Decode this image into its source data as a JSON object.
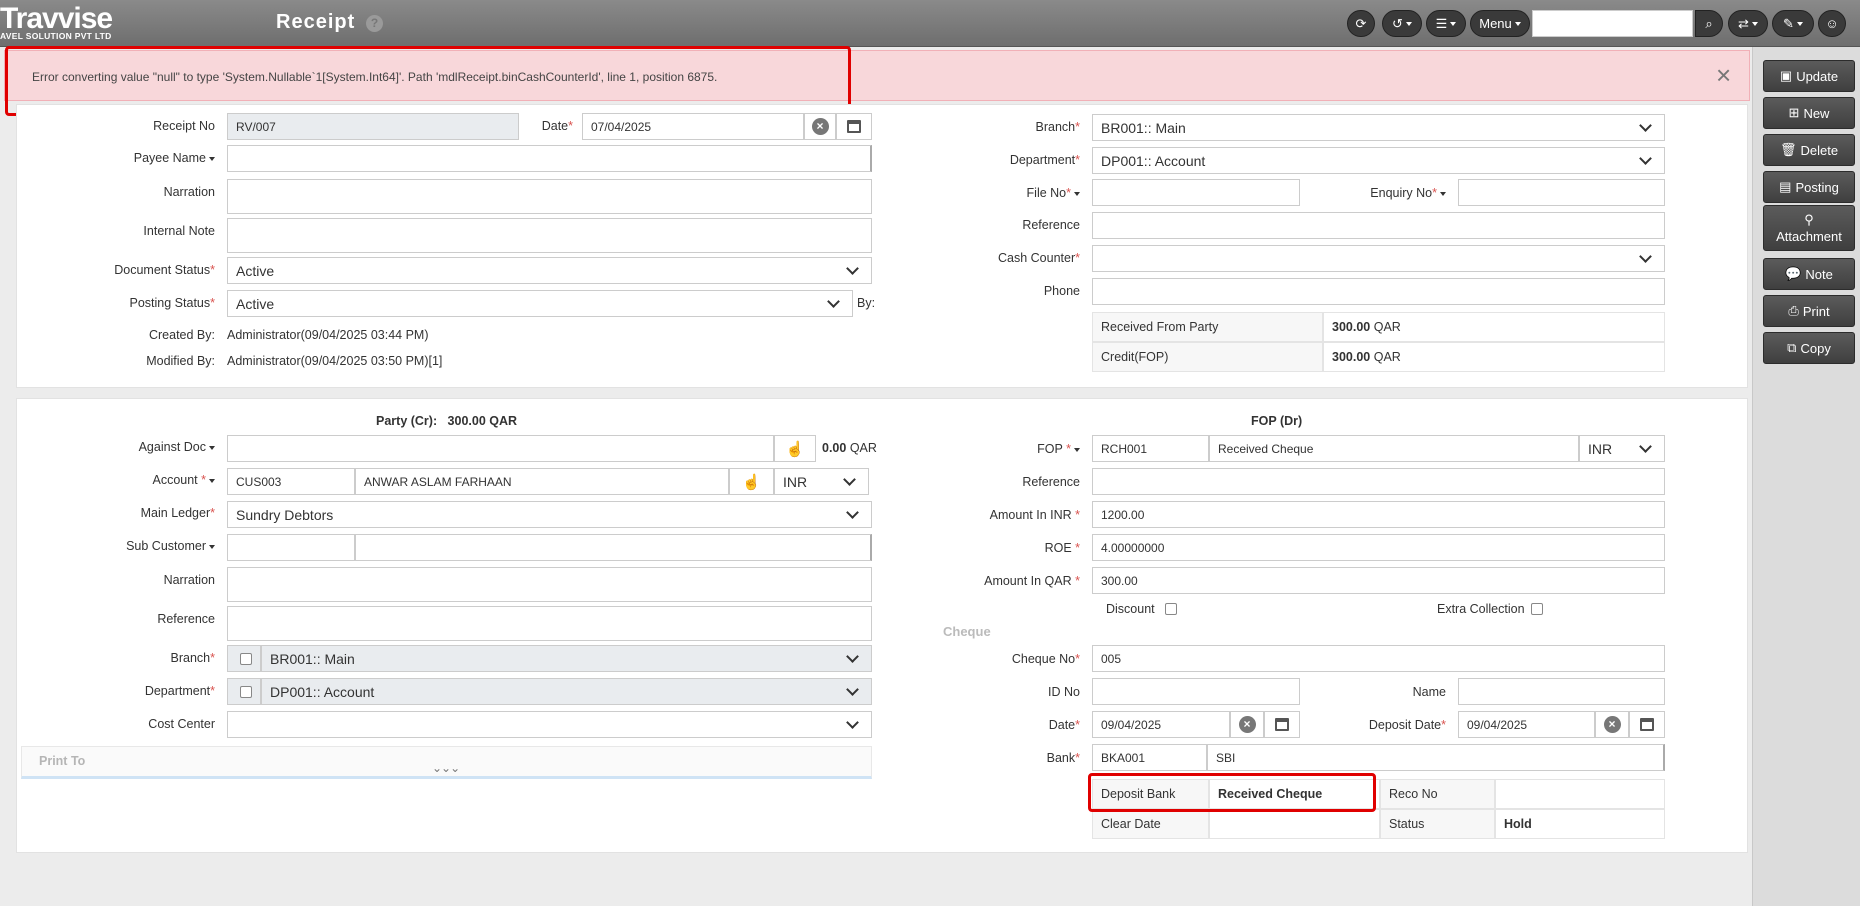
{
  "header": {
    "logo": "Travvise",
    "logo_sub": "AVEL SOLUTION PVT LTD",
    "title": "Receipt",
    "help": "?",
    "menu": "Menu",
    "search_value": ""
  },
  "alert": {
    "message": "Error converting value \"null\" to type 'System.Nullable`1[System.Int64]'. Path 'mdlReceipt.binCashCounterId', line 1, position 6875.",
    "close": "×"
  },
  "sidebar": {
    "update": "Update",
    "new": "New",
    "delete": "Delete",
    "posting": "Posting",
    "attachment": "Attachment",
    "note": "Note",
    "print": "Print",
    "copy": "Copy"
  },
  "top_left": {
    "receipt_no_label": "Receipt No",
    "receipt_no": "RV/007",
    "date_label": "Date",
    "date": "07/04/2025",
    "payee_label": "Payee Name",
    "payee": "",
    "narration_label": "Narration",
    "internal_note_label": "Internal Note",
    "doc_status_label": "Document Status",
    "doc_status": "Active",
    "posting_status_label": "Posting Status",
    "posting_status": "Active",
    "by_label": "By:",
    "created_by_label": "Created By:",
    "created_by": "Administrator(09/04/2025 03:44 PM)",
    "modified_by_label": "Modified By:",
    "modified_by": "Administrator(09/04/2025 03:50 PM)[1]"
  },
  "top_right": {
    "branch_label": "Branch",
    "branch": "BR001:: Main",
    "department_label": "Department",
    "department": "DP001:: Account",
    "file_no_label": "File No",
    "enquiry_no_label": "Enquiry No",
    "reference_label": "Reference",
    "cash_counter_label": "Cash Counter",
    "phone_label": "Phone",
    "received_from_label": "Received From Party",
    "received_from_amount": "300.00",
    "received_from_cur": "QAR",
    "credit_label": "Credit(FOP)",
    "credit_amount": "300.00",
    "credit_cur": "QAR"
  },
  "party": {
    "heading_label": "Party (Cr):",
    "heading_value": "300.00 QAR",
    "against_doc_label": "Against Doc",
    "against_amount": "0.00",
    "against_cur": "QAR",
    "account_label": "Account",
    "account_code": "CUS003",
    "account_name": "ANWAR ASLAM FARHAAN",
    "account_cur": "INR",
    "main_ledger_label": "Main Ledger",
    "main_ledger": "Sundry Debtors",
    "sub_customer_label": "Sub Customer",
    "narration_label": "Narration",
    "reference_label": "Reference",
    "branch_label": "Branch",
    "branch": "BR001:: Main",
    "department_label": "Department",
    "department": "DP001:: Account",
    "cost_center_label": "Cost Center",
    "print_to": "Print To",
    "expand": "⌄⌄⌄"
  },
  "fop": {
    "heading": "FOP (Dr)",
    "fop_label": "FOP",
    "fop_code": "RCH001",
    "fop_name": "Received Cheque",
    "fop_cur": "INR",
    "reference_label": "Reference",
    "amount_inr_label": "Amount In INR",
    "amount_inr": "1200.00",
    "roe_label": "ROE",
    "roe": "4.00000000",
    "amount_qar_label": "Amount In QAR",
    "amount_qar": "300.00",
    "discount_label": "Discount",
    "extra_label": "Extra Collection",
    "cheque_section": "Cheque",
    "cheque_no_label": "Cheque No",
    "cheque_no": "005",
    "id_no_label": "ID No",
    "name_label": "Name",
    "date_label": "Date",
    "date": "09/04/2025",
    "deposit_date_label": "Deposit Date",
    "deposit_date": "09/04/2025",
    "bank_label": "Bank",
    "bank_code": "BKA001",
    "bank_name": "SBI",
    "deposit_bank_label": "Deposit Bank",
    "deposit_bank": "Received Cheque",
    "reco_no_label": "Reco No",
    "clear_date_label": "Clear Date",
    "status_label": "Status",
    "status": "Hold"
  }
}
